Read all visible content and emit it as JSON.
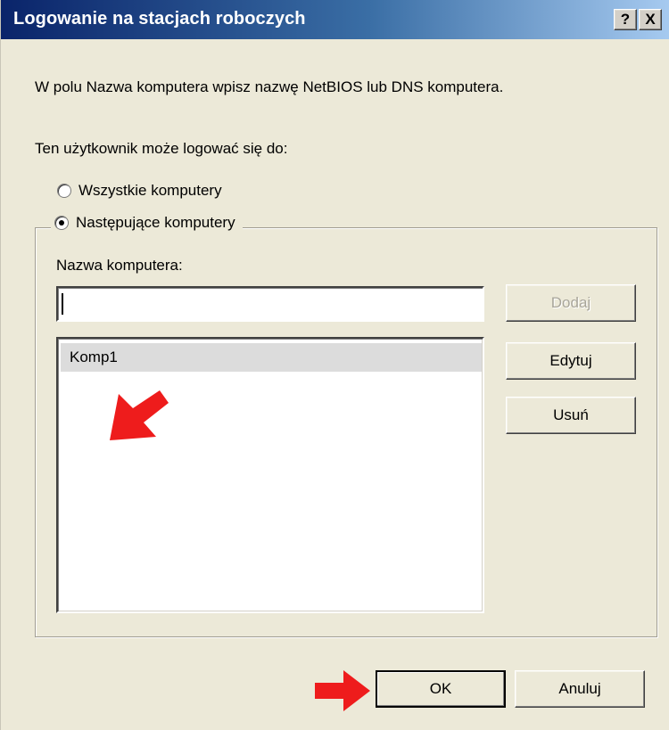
{
  "window": {
    "title": "Logowanie na stacjach roboczych",
    "help_label": "?",
    "close_label": "X"
  },
  "dialog": {
    "instruction": "W polu Nazwa komputera wpisz nazwę NetBIOS lub DNS komputera.",
    "section_label": "Ten użytkownik może logować się do:",
    "radio_all": "Wszystkie komputery",
    "radio_selected": "Następujące komputery",
    "selected_option": "radio_selected",
    "computer_name_label": "Nazwa komputera:",
    "computer_name_value": "",
    "computers": [
      "Komp1"
    ]
  },
  "buttons": {
    "add": "Dodaj",
    "edit": "Edytuj",
    "remove": "Usuń",
    "ok": "OK",
    "cancel": "Anuluj"
  },
  "annotations": {
    "arrow_color": "#ee1c1c"
  }
}
